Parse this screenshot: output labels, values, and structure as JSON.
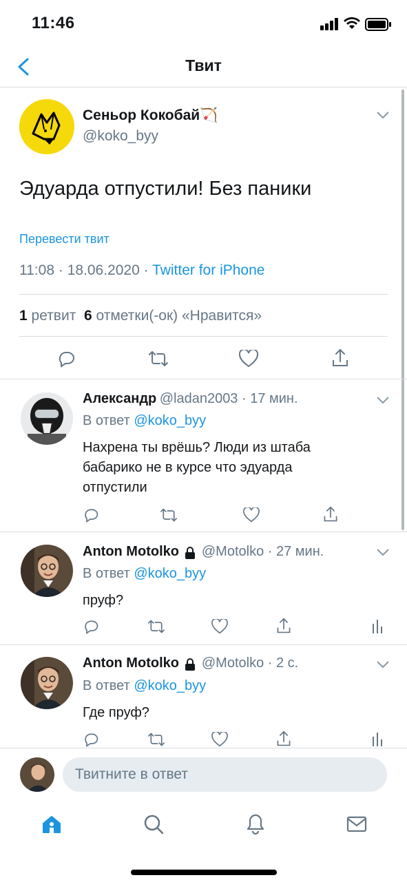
{
  "status_bar": {
    "time": "11:46"
  },
  "header": {
    "title": "Твит"
  },
  "main_tweet": {
    "author_name": "Сеньор Кокобай",
    "author_emoji": "🏹",
    "handle": "@koko_byy",
    "text": "Эдуарда отпустили! Без паники",
    "translate_label": "Перевести твит",
    "timestamp": "11:08 · 18.06.2020 · ",
    "source": "Twitter for iPhone",
    "retweet_count": "1",
    "retweet_label": "ретвит",
    "like_count": "6",
    "like_label": "отметки(-ок) «Нравится»"
  },
  "replies": [
    {
      "name": "Александр",
      "meta": "@ladan2003 · 17 мин.",
      "reply_to_prefix": "В ответ",
      "reply_to": "@koko_byy",
      "text_lines": [
        "Нахрена ты врёшь? Люди из штаба",
        "бабарико не в курсе что эдуарда",
        "отпустили"
      ]
    },
    {
      "name": "Anton Motolko",
      "meta": "@Motolko · 27 мин.",
      "reply_to_prefix": "В ответ",
      "reply_to": "@koko_byy",
      "text_lines": [
        "пруф?"
      ]
    },
    {
      "name": "Anton Motolko",
      "meta": "@Motolko · 2 с.",
      "reply_to_prefix": "В ответ",
      "reply_to": "@koko_byy",
      "text_lines": [
        "Где пруф?"
      ]
    }
  ],
  "composer": {
    "placeholder": "Твитните в ответ"
  },
  "colors": {
    "accent": "#1b95e0",
    "secondary": "#657786",
    "divider": "#d7dbdf",
    "avatar_yellow": "#f5d90a"
  }
}
